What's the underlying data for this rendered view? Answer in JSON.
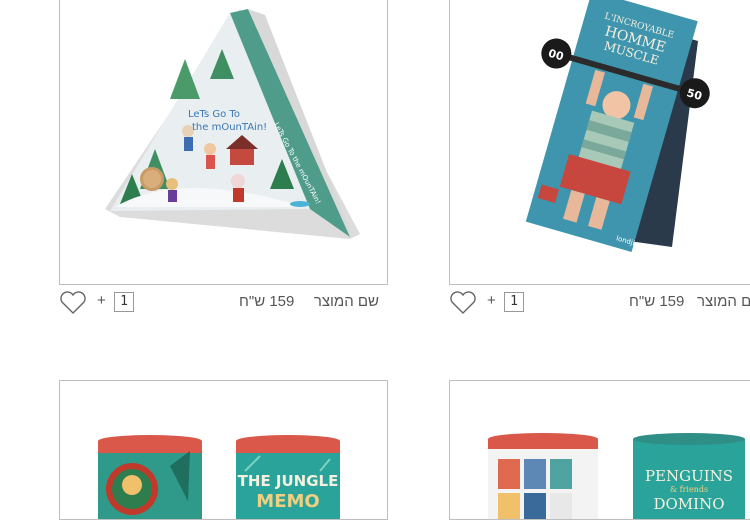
{
  "products": [
    {
      "name": "שם המוצר",
      "price": "159 ש\"ח",
      "quantity": "1",
      "plus_label": "+",
      "box_text": "LeTs Go To the mOunTAin!",
      "wishlist_icon": "heart-icon"
    },
    {
      "name": "שם המוצר",
      "price": "159 ש\"ח",
      "quantity": "1",
      "plus_label": "+",
      "box_text": "L'INCROYABLE HOMME MUSCLE",
      "weights": [
        "00",
        "50"
      ],
      "wishlist_icon": "heart-icon"
    },
    {
      "box_text": "THE JUNGLE MEMO"
    },
    {
      "box_text": "PENGUINS & friends DOMINO"
    }
  ],
  "colors": {
    "card_border": "#bfbfbf",
    "text": "#555555"
  }
}
